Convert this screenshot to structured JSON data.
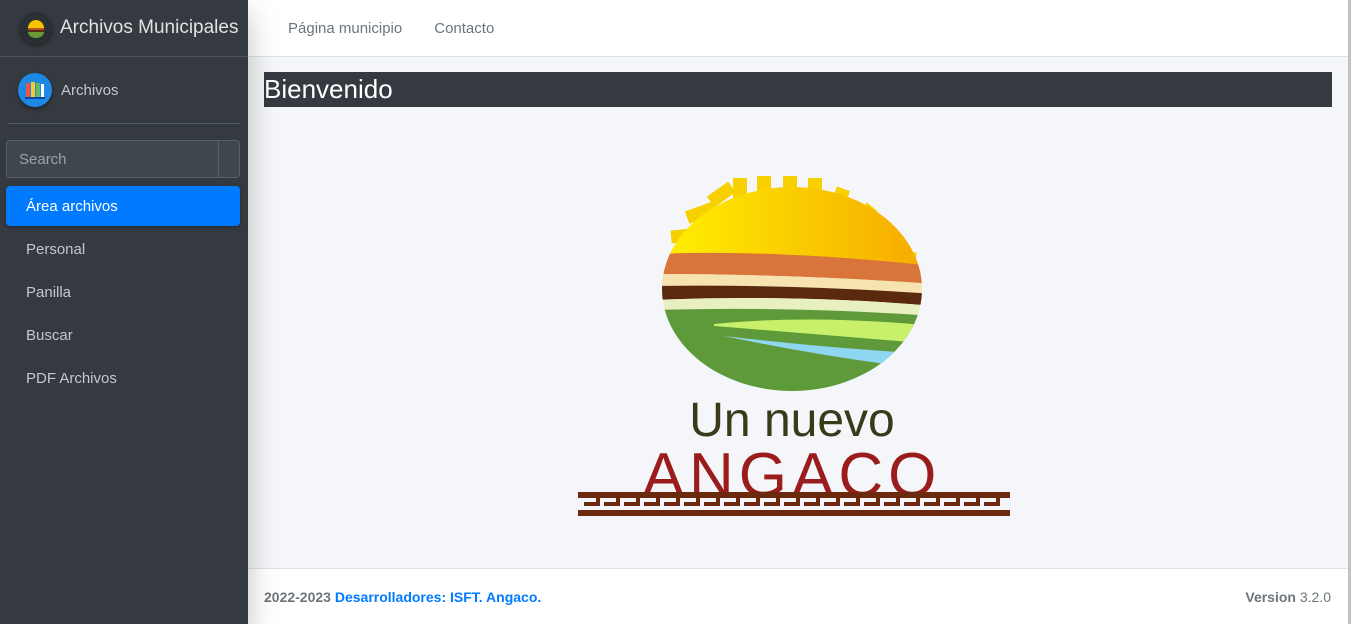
{
  "brand": {
    "title": "Archivos Municipales"
  },
  "user": {
    "name": "Archivos"
  },
  "search": {
    "placeholder": "Search"
  },
  "sidebar": {
    "items": [
      {
        "label": "Área archivos",
        "active": true
      },
      {
        "label": "Personal"
      },
      {
        "label": "Panilla"
      },
      {
        "label": "Buscar"
      },
      {
        "label": "PDF Archivos"
      }
    ]
  },
  "topnav": {
    "items": [
      "Página municipio",
      "Contacto"
    ]
  },
  "main": {
    "heading": "Bienvenido",
    "logo": {
      "line1": "Un nuevo",
      "line2": "ANGACO"
    }
  },
  "footer": {
    "years": "2022-2023",
    "developers": "Desarrolladores: ISFT. Angaco.",
    "version_label": "Version",
    "version_value": "3.2.0"
  },
  "colors": {
    "sidebar": "#343a40",
    "accent": "#007bff",
    "logo_red": "#9b1c1c",
    "logo_brown": "#6b2a0e"
  }
}
